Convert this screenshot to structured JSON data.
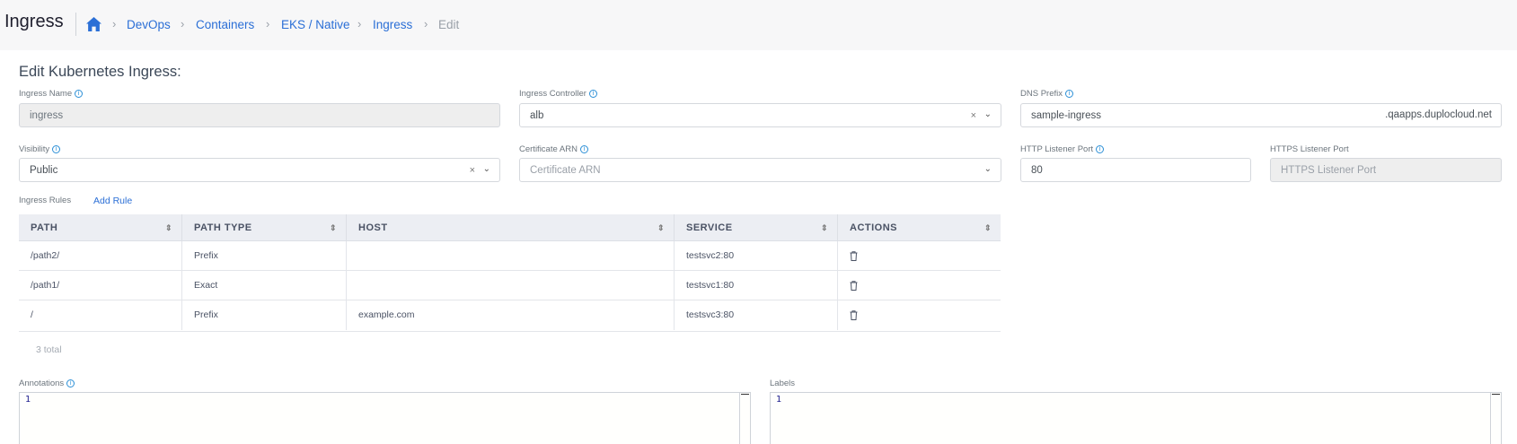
{
  "header": {
    "title": "Ingress",
    "breadcrumb": [
      "DevOps",
      "Containers",
      "EKS / Native",
      "Ingress"
    ],
    "current": "Edit",
    "separator": "›"
  },
  "form": {
    "title": "Edit Kubernetes Ingress:",
    "ingress_name": {
      "label": "Ingress Name",
      "value": "ingress"
    },
    "ingress_controller": {
      "label": "Ingress Controller",
      "value": "alb"
    },
    "dns_prefix": {
      "label": "DNS Prefix",
      "value": "sample-ingress",
      "suffix": ".qaapps.duplocloud.net"
    },
    "visibility": {
      "label": "Visibility",
      "value": "Public"
    },
    "certificate_arn": {
      "label": "Certificate ARN",
      "placeholder": "Certificate ARN"
    },
    "http_port": {
      "label": "HTTP Listener Port",
      "value": "80"
    },
    "https_port": {
      "label": "HTTPS Listener Port",
      "placeholder": "HTTPS Listener Port"
    }
  },
  "rules": {
    "label": "Ingress Rules",
    "add_label": "Add Rule",
    "columns": [
      "PATH",
      "PATH TYPE",
      "HOST",
      "SERVICE",
      "ACTIONS"
    ],
    "rows": [
      [
        "/path2/",
        "Prefix",
        "",
        "testsvc2:80"
      ],
      [
        "/path1/",
        "Exact",
        "",
        "testsvc1:80"
      ],
      [
        "/",
        "Prefix",
        "example.com",
        "testsvc3:80"
      ]
    ],
    "total": "3 total"
  },
  "annotations": {
    "label": "Annotations",
    "line": "1"
  },
  "labels": {
    "label": "Labels",
    "line": "1"
  },
  "icons": {
    "clear": "×",
    "chevron": "⌄",
    "sort": "⇕",
    "info": "i"
  }
}
